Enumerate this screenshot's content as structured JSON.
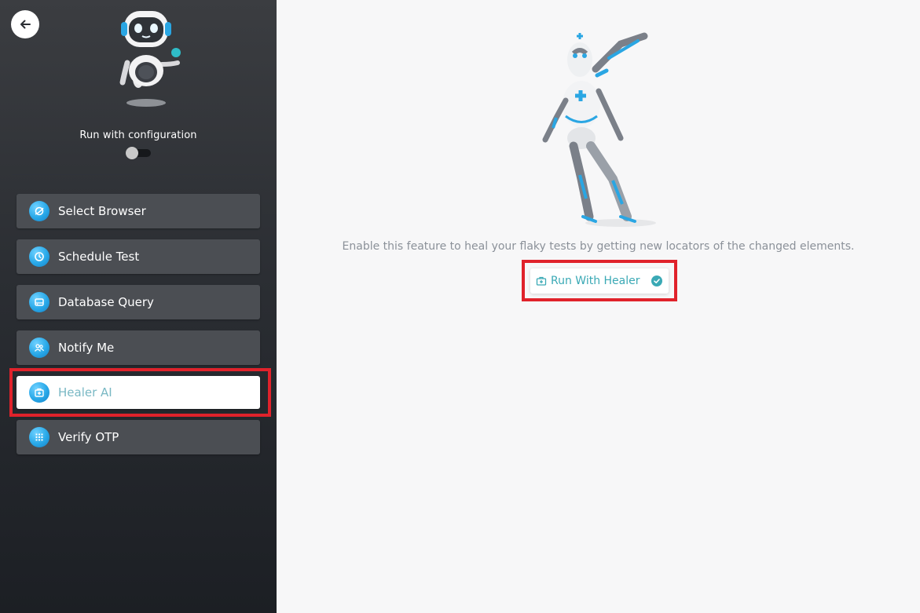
{
  "sidebar": {
    "config_label": "Run with configuration",
    "config_toggle_on": false,
    "items": [
      {
        "label": "Select Browser",
        "icon": "browser-icon",
        "active": false
      },
      {
        "label": "Schedule Test",
        "icon": "clock-icon",
        "active": false
      },
      {
        "label": "Database Query",
        "icon": "database-icon",
        "active": false
      },
      {
        "label": "Notify Me",
        "icon": "users-icon",
        "active": false
      },
      {
        "label": "Healer AI",
        "icon": "medkit-icon",
        "active": true
      },
      {
        "label": "Verify OTP",
        "icon": "keypad-icon",
        "active": false
      }
    ]
  },
  "main": {
    "description": "Enable this feature to heal your flaky tests by getting new locators of the changed elements.",
    "healer_button_label": "Run With Healer",
    "healer_enabled": true
  },
  "colors": {
    "accent": "#3aa9b5",
    "highlight": "#e0222b",
    "sidebar_bg": "#2b2e33",
    "icon_blue": "#28a8e8"
  }
}
